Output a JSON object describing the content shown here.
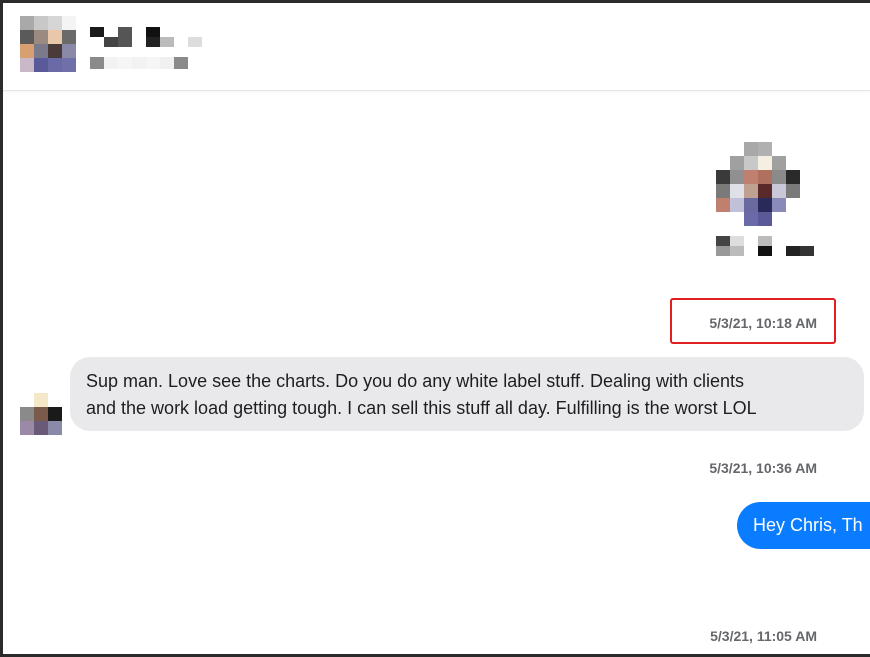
{
  "header": {
    "contact_name_redacted": true
  },
  "messages": [
    {
      "timestamp": "5/3/21, 10:18 AM",
      "direction": "incoming",
      "text": "Sup man. Love see the charts. Do you do any white label stuff. Dealing with clients\nand the work load getting tough. I can sell this stuff all day. Fulfilling is the worst LOL"
    },
    {
      "timestamp": "5/3/21, 10:36 AM",
      "direction": "outgoing",
      "text": "Hey Chris, Th"
    },
    {
      "timestamp": "5/3/21, 11:05 AM"
    }
  ],
  "colors": {
    "incoming_bubble": "#e9e9eb",
    "outgoing_bubble": "#0a7cff",
    "timestamp_text": "#65676b",
    "highlight_box": "#e02020"
  },
  "icons": {
    "header_avatar": "pixelated-avatar",
    "profile_avatar": "pixelated-avatar",
    "message_avatar": "pixelated-avatar"
  }
}
